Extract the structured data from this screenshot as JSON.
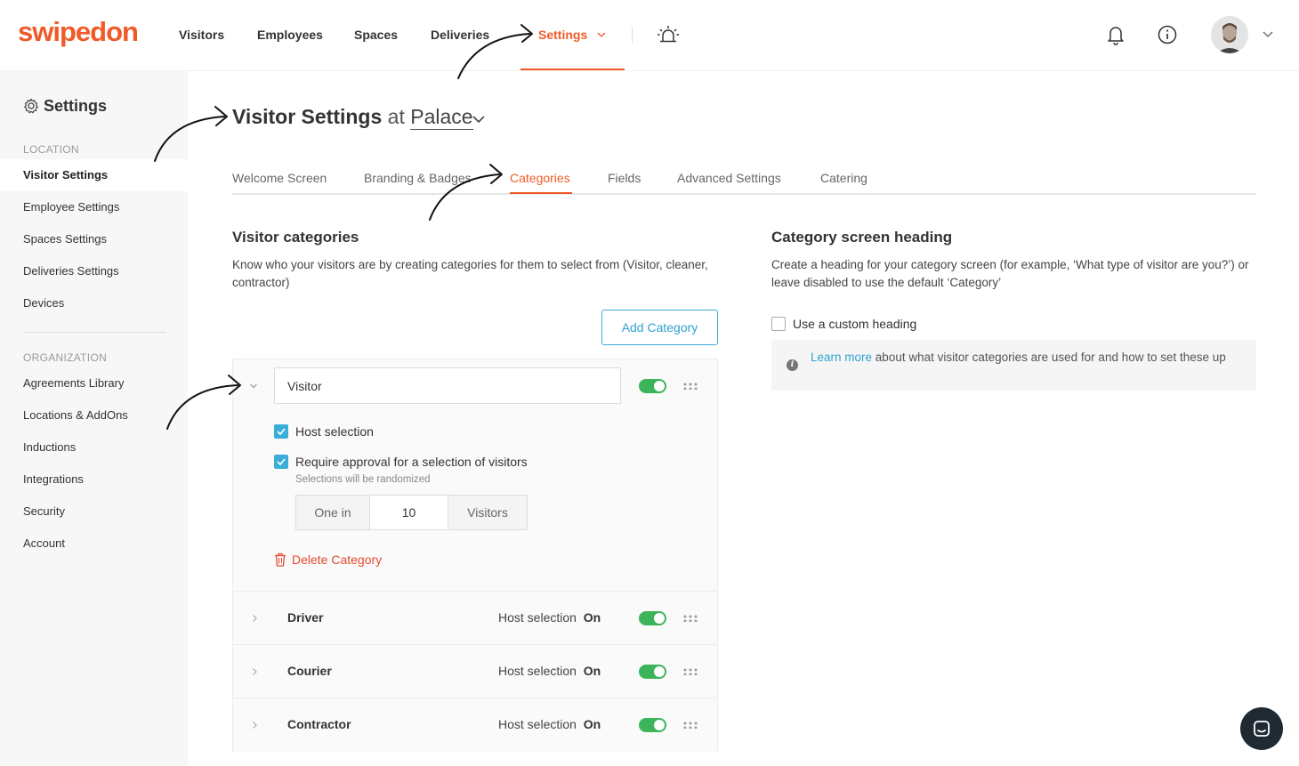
{
  "app": {
    "logo": "swipedon"
  },
  "nav": {
    "items": [
      "Visitors",
      "Employees",
      "Spaces",
      "Deliveries",
      "Settings"
    ]
  },
  "sidebar": {
    "title": "Settings",
    "section_location": "LOCATION",
    "location_items": [
      "Visitor Settings",
      "Employee Settings",
      "Spaces Settings",
      "Deliveries Settings",
      "Devices"
    ],
    "section_org": "ORGANIZATION",
    "org_items": [
      "Agreements Library",
      "Locations & AddOns",
      "Inductions",
      "Integrations",
      "Security",
      "Account"
    ]
  },
  "page": {
    "title": "Visitor Settings",
    "at": "at",
    "location": "Palace"
  },
  "tabs": [
    "Welcome Screen",
    "Branding & Badges",
    "Categories",
    "Fields",
    "Advanced Settings",
    "Catering"
  ],
  "visitor_categories": {
    "heading": "Visitor categories",
    "description": "Know who your visitors are by creating categories for them to select from (Visitor, cleaner, contractor)",
    "add_button": "Add Category",
    "expanded": {
      "name": "Visitor",
      "host_selection_label": "Host selection",
      "approval_label": "Require approval for a selection of visitors",
      "approval_note": "Selections will be randomized",
      "ratio_prefix": "One in",
      "ratio_value": "10",
      "ratio_suffix": "Visitors",
      "delete_label": "Delete Category",
      "enabled": true
    },
    "rows": [
      {
        "name": "Driver",
        "host_label": "Host selection",
        "host_value": "On",
        "enabled": true
      },
      {
        "name": "Courier",
        "host_label": "Host selection",
        "host_value": "On",
        "enabled": true
      },
      {
        "name": "Contractor",
        "host_label": "Host selection",
        "host_value": "On",
        "enabled": true
      }
    ]
  },
  "category_heading": {
    "heading": "Category screen heading",
    "description": "Create a heading for your category screen (for example, ‘What type of visitor are you?’) or leave disabled to use the default ‘Category’",
    "custom_label": "Use a custom heading",
    "info_link": "Learn more",
    "info_text": " about what visitor categories are used for and how to set these up"
  },
  "colors": {
    "accent": "#f05a28",
    "link": "#2ea3d1",
    "toggle_on": "#3cb55a"
  }
}
